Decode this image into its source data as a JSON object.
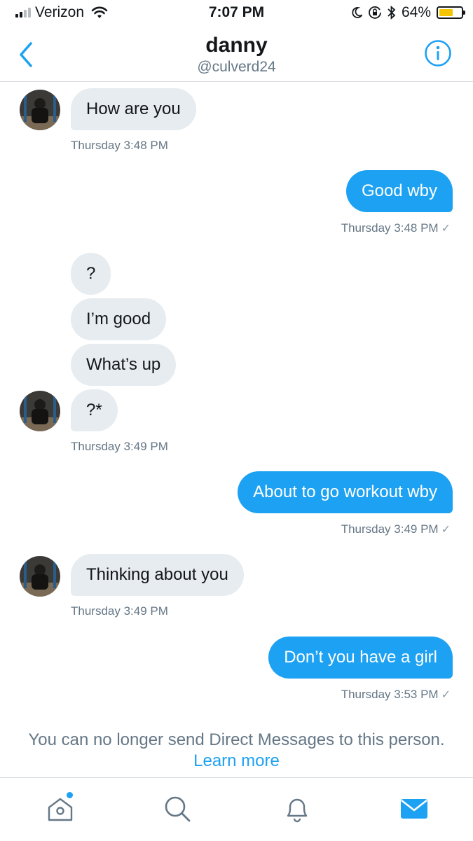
{
  "status_bar": {
    "carrier": "Verizon",
    "time": "7:07 PM",
    "battery_percent": "64%",
    "battery_level": 0.64,
    "icons": [
      "signal-icon",
      "wifi-icon",
      "moon-icon",
      "orientation-lock-icon",
      "bluetooth-icon",
      "battery-icon"
    ]
  },
  "header": {
    "name": "danny",
    "handle": "@culverd24",
    "back_icon": "chevron-left-icon",
    "info_icon": "info-icon"
  },
  "messages": [
    {
      "direction": "in",
      "text": "How are you"
    },
    {
      "timestamp": "Thursday 3:48 PM"
    },
    {
      "direction": "out",
      "text": "Good wby"
    },
    {
      "timestamp": "Thursday 3:48 PM"
    },
    {
      "direction": "in",
      "text": "?"
    },
    {
      "direction": "in",
      "text": "I’m good"
    },
    {
      "direction": "in",
      "text": "What’s up"
    },
    {
      "direction": "in",
      "text": "?*"
    },
    {
      "timestamp": "Thursday 3:49 PM"
    },
    {
      "direction": "out",
      "text": "About to go workout wby"
    },
    {
      "timestamp": "Thursday 3:49 PM"
    },
    {
      "direction": "in",
      "text": "Thinking about you"
    },
    {
      "timestamp": "Thursday 3:49 PM"
    },
    {
      "direction": "out",
      "text": "Don’t you have a girl"
    },
    {
      "timestamp": "Thursday 3:53 PM"
    }
  ],
  "read_check": "✓",
  "notice": {
    "text": "You can no longer send Direct Messages to this person.",
    "link": "Learn more"
  },
  "tabs": [
    {
      "name": "home",
      "icon": "home-icon",
      "badge": true
    },
    {
      "name": "search",
      "icon": "search-icon"
    },
    {
      "name": "notifications",
      "icon": "bell-icon"
    },
    {
      "name": "messages",
      "icon": "mail-icon",
      "active": true
    }
  ],
  "colors": {
    "accent": "#1da1f2",
    "incoming_bubble": "#e6ecf0",
    "secondary_text": "#657786",
    "battery_fill": "#f5c400"
  }
}
